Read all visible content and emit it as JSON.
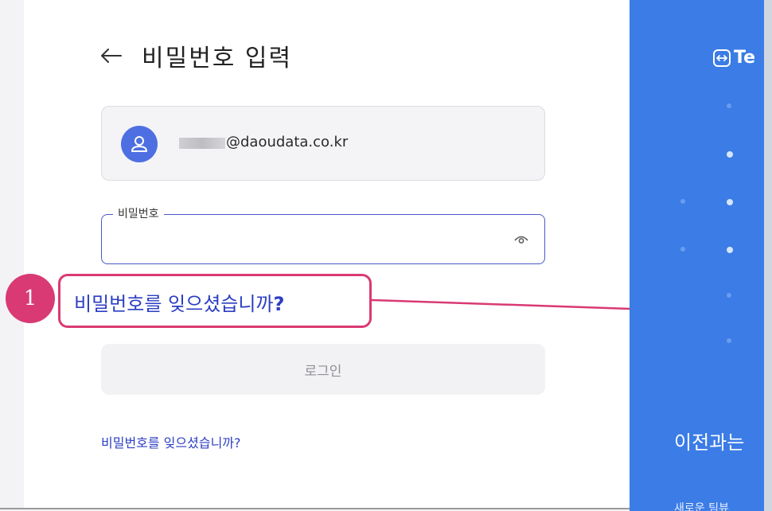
{
  "header": {
    "title": "비밀번호 입력"
  },
  "account": {
    "email": "@daoudata.co.kr"
  },
  "password_field": {
    "label": "비밀번호",
    "value": ""
  },
  "forgot_highlight": {
    "text": "비밀번호를 잊으셨습니까",
    "question_mark": "?"
  },
  "callout": {
    "number": "1"
  },
  "login_button": {
    "label": "로그인"
  },
  "forgot_link": {
    "label": "비밀번호를 잊으셨습니까?"
  },
  "right_panel": {
    "logo_text": "Te",
    "promo_text": "이전과는",
    "promo_sub": "새로운 팀뷰"
  },
  "colors": {
    "accent": "#4a58c8",
    "link": "#2b3ec2",
    "callout": "#d93a73",
    "brand": "#3b7ce6"
  }
}
